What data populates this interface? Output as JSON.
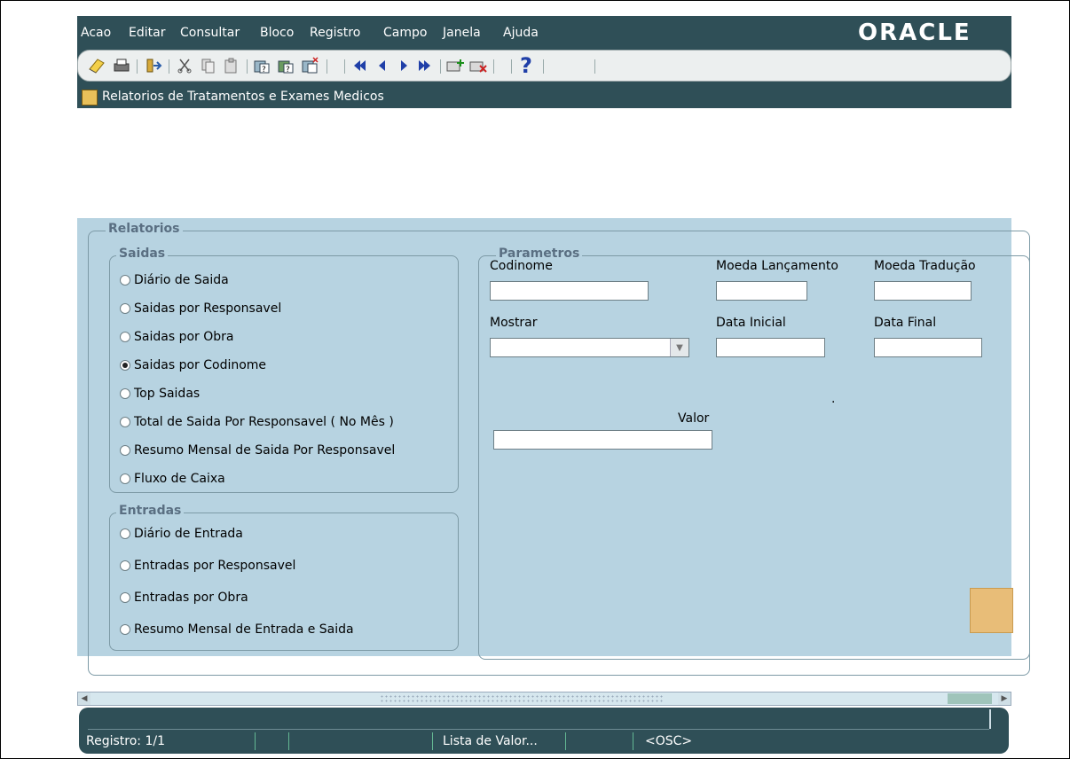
{
  "menu": {
    "items": [
      "Acao",
      "Editar",
      "Consultar",
      "Bloco",
      "Registro",
      "Campo",
      "Janela",
      "Ajuda"
    ],
    "brand": "ORACLE"
  },
  "toolbar": {
    "icons": [
      "save-icon",
      "print-icon",
      "exit-icon",
      "cut-icon",
      "copy-icon",
      "paste-icon",
      "enter-query-icon",
      "execute-query-icon",
      "cancel-query-icon",
      "first-record-icon",
      "previous-record-icon",
      "next-record-icon",
      "last-record-icon",
      "insert-record-icon",
      "delete-record-icon",
      "help-icon"
    ],
    "help_glyph": "?"
  },
  "window": {
    "title": "Relatorios de Tratamentos e Exames Medicos"
  },
  "form": {
    "relatorios_label": "Relatorios",
    "saidas": {
      "label": "Saidas",
      "options": [
        {
          "label": "Diário de Saida",
          "selected": false
        },
        {
          "label": "Saidas por Responsavel",
          "selected": false
        },
        {
          "label": "Saidas por Obra",
          "selected": false
        },
        {
          "label": "Saidas por Codinome",
          "selected": true
        },
        {
          "label": "Top Saidas",
          "selected": false
        },
        {
          "label": "Total de Saida Por Responsavel ( No Mês )",
          "selected": false
        },
        {
          "label": "Resumo Mensal de Saida Por Responsavel",
          "selected": false
        },
        {
          "label": "Fluxo de Caixa",
          "selected": false
        }
      ]
    },
    "entradas": {
      "label": "Entradas",
      "options": [
        {
          "label": "Diário de Entrada",
          "selected": false
        },
        {
          "label": "Entradas por Responsavel",
          "selected": false
        },
        {
          "label": "Entradas por Obra",
          "selected": false
        },
        {
          "label": "Resumo Mensal de Entrada e Saida",
          "selected": false
        }
      ]
    },
    "parametros": {
      "label": "Parametros",
      "codinome_label": "Codinome",
      "codinome_value": "",
      "moeda_lancamento_label": "Moeda Lançamento",
      "moeda_lancamento_value": "",
      "moeda_traducao_label": "Moeda Tradução",
      "moeda_traducao_value": "",
      "mostrar_label": "Mostrar",
      "mostrar_value": "",
      "data_inicial_label": "Data Inicial",
      "data_inicial_value": "",
      "data_final_label": "Data Final",
      "data_final_value": "",
      "valor_label": "Valor",
      "valor_value": "",
      "dot": "."
    }
  },
  "status": {
    "registro": "Registro: 1/1",
    "lista": "Lista de Valor...",
    "osc": "<OSC>"
  },
  "colors": {
    "frame": "#2f4f57",
    "form_bg": "#b7d3e1",
    "group_title": "#5a6f82",
    "button_accent": "#e8bd78"
  }
}
